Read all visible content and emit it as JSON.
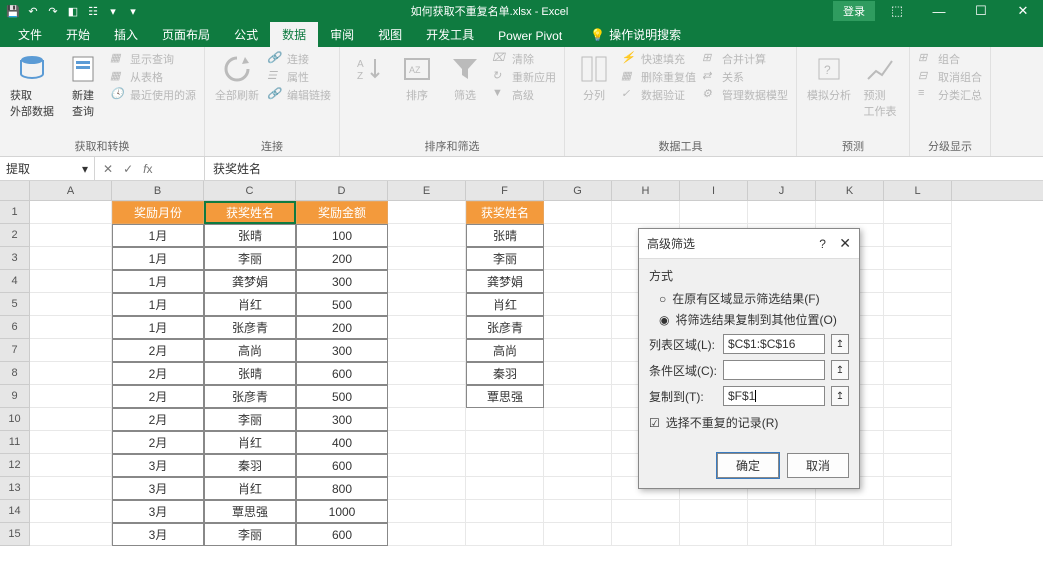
{
  "title": "如何获取不重复名单.xlsx  -  Excel",
  "login": "登录",
  "tabs": {
    "file": "文件",
    "home": "开始",
    "insert": "插入",
    "layout": "页面布局",
    "formula": "公式",
    "data": "数据",
    "review": "审阅",
    "view": "视图",
    "dev": "开发工具",
    "pp": "Power Pivot",
    "tell": "操作说明搜索"
  },
  "ribbon": {
    "g1": {
      "label": "获取和转换",
      "getext": "获取\n外部数据",
      "newquery": "新建\n查询",
      "show": "显示查询",
      "fromtable": "从表格",
      "recent": "最近使用的源"
    },
    "g2": {
      "label": "连接",
      "refresh": "全部刷新",
      "conn": "连接",
      "prop": "属性",
      "editlink": "编辑链接"
    },
    "g3": {
      "label": "排序和筛选",
      "sort": "排序",
      "filter": "筛选",
      "clear": "清除",
      "reapply": "重新应用",
      "adv": "高级"
    },
    "g4": {
      "label": "数据工具",
      "texttocol": "分列",
      "flash": "快速填充",
      "dedup": "删除重复值",
      "validate": "数据验证",
      "consol": "合并计算",
      "relation": "关系",
      "model": "管理数据模型"
    },
    "g5": {
      "label": "预测",
      "whatif": "模拟分析",
      "forecast": "预测\n工作表"
    },
    "g6": {
      "label": "分级显示",
      "group": "组合",
      "ungroup": "取消组合",
      "subtotal": "分类汇总"
    }
  },
  "namebox": "提取",
  "formula": "获奖姓名",
  "headers": {
    "b": "奖励月份",
    "c": "获奖姓名",
    "d": "奖励金额",
    "f": "获奖姓名"
  },
  "rowsB": [
    "1月",
    "1月",
    "1月",
    "1月",
    "1月",
    "2月",
    "2月",
    "2月",
    "2月",
    "2月",
    "3月",
    "3月",
    "3月",
    "3月"
  ],
  "rowsC": [
    "张晴",
    "李丽",
    "龚梦娟",
    "肖红",
    "张彦青",
    "高尚",
    "张晴",
    "张彦青",
    "李丽",
    "肖红",
    "秦羽",
    "肖红",
    "覃思强",
    "李丽"
  ],
  "rowsD": [
    "100",
    "200",
    "300",
    "500",
    "200",
    "300",
    "600",
    "500",
    "300",
    "400",
    "600",
    "800",
    "1000",
    "600"
  ],
  "rowsF": [
    "张晴",
    "李丽",
    "龚梦娟",
    "肖红",
    "张彦青",
    "高尚",
    "秦羽",
    "覃思强"
  ],
  "dialog": {
    "title": "高级筛选",
    "method": "方式",
    "opt1": "在原有区域显示筛选结果(F)",
    "opt2": "将筛选结果复制到其他位置(O)",
    "listlabel": "列表区域(L):",
    "listval": "$C$1:$C$16",
    "critlabel": "条件区域(C):",
    "critval": "",
    "copylabel": "复制到(T):",
    "copyval": "$F$1",
    "unique": "选择不重复的记录(R)",
    "ok": "确定",
    "cancel": "取消"
  }
}
